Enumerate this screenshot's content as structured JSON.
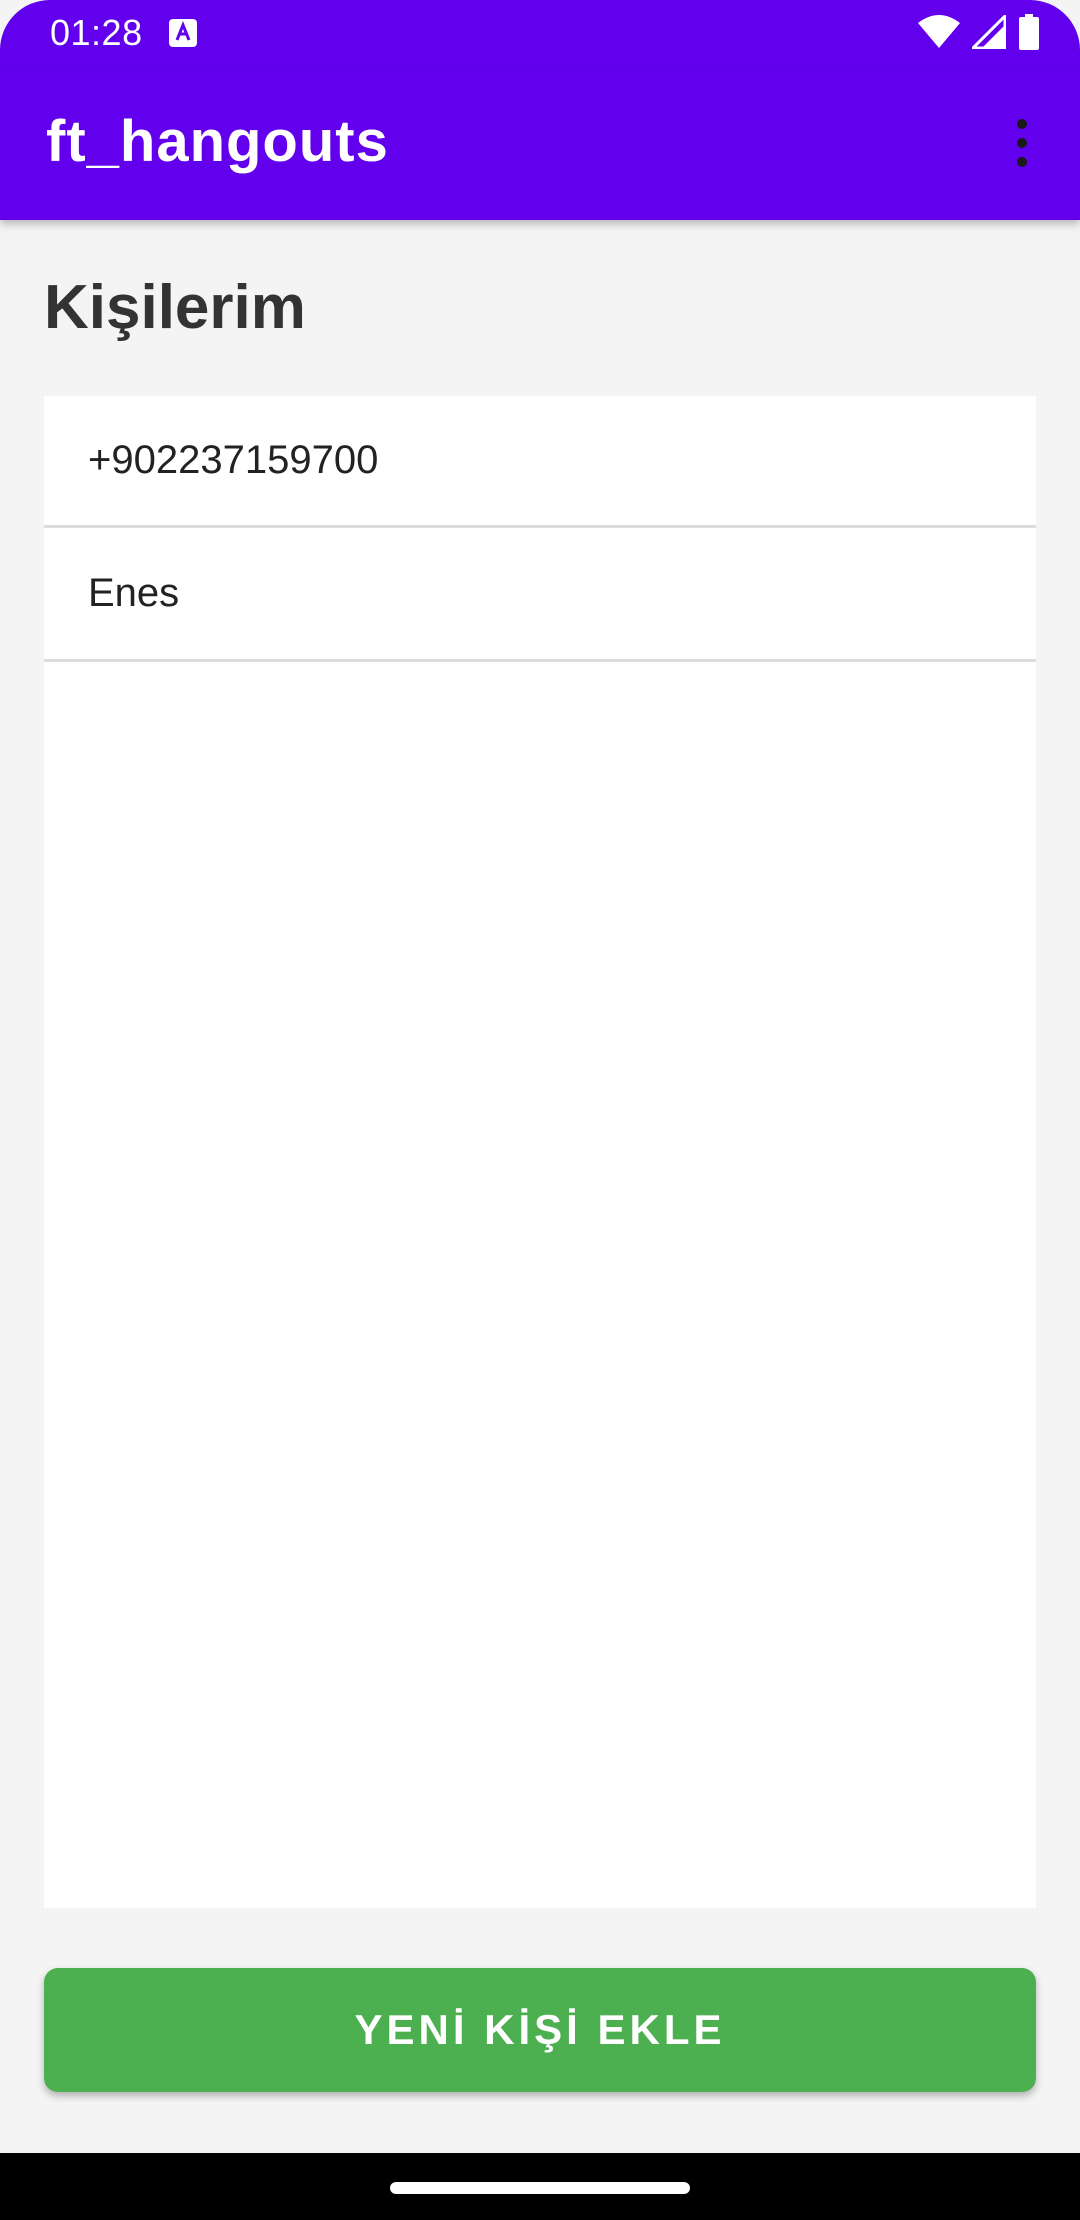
{
  "status_bar": {
    "time": "01:28",
    "icons": [
      "notification-a-icon",
      "wifi-icon",
      "cellular-signal-icon",
      "battery-icon"
    ]
  },
  "app_bar": {
    "title": "ft_hangouts",
    "menu_icon": "more-vert-icon"
  },
  "main": {
    "heading": "Kişilerim",
    "contacts": [
      {
        "label": "+902237159700"
      },
      {
        "label": "Enes"
      }
    ],
    "add_button_label": "YENİ KİŞİ EKLE"
  },
  "colors": {
    "primary": "#6200ee",
    "button": "#4caf50",
    "background": "#f4f4f4",
    "list_background": "#ffffff",
    "heading_text": "#333333"
  }
}
